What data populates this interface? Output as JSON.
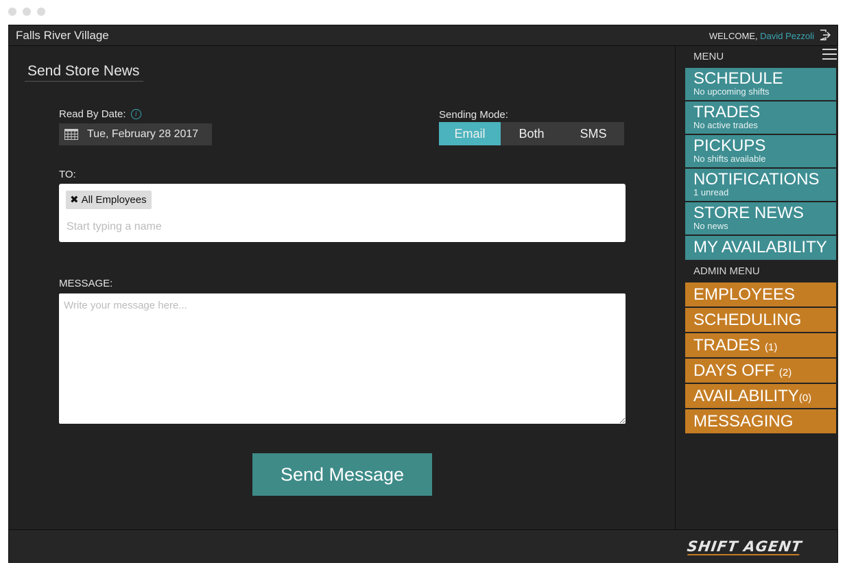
{
  "header": {
    "store_name": "Falls River Village",
    "welcome_label": "WELCOME,",
    "user_name": "David Pezzoli"
  },
  "main": {
    "page_title": "Send Store News",
    "read_by_label": "Read By Date:",
    "read_by_value": "Tue, February 28 2017",
    "sending_mode_label": "Sending Mode:",
    "modes": [
      "Email",
      "Both",
      "SMS"
    ],
    "selected_mode": "Email",
    "to_label": "TO:",
    "to_chip": "All Employees",
    "to_placeholder": "Start typing a name",
    "message_label": "MESSAGE:",
    "message_placeholder": "Write your message here...",
    "send_button": "Send Message"
  },
  "sidebar": {
    "menu_title": "MENU",
    "items": [
      {
        "label": "SCHEDULE",
        "sub": "No upcoming shifts"
      },
      {
        "label": "TRADES",
        "sub": "No active trades"
      },
      {
        "label": "PICKUPS",
        "sub": "No shifts available"
      },
      {
        "label": "NOTIFICATIONS",
        "sub": "1 unread"
      },
      {
        "label": "STORE NEWS",
        "sub": "No news"
      },
      {
        "label": "MY AVAILABILITY",
        "sub": ""
      }
    ],
    "admin_title": "ADMIN MENU",
    "admin_items": [
      {
        "label": "EMPLOYEES",
        "count": ""
      },
      {
        "label": "SCHEDULING",
        "count": ""
      },
      {
        "label": "TRADES ",
        "count": "(1)"
      },
      {
        "label": "DAYS OFF ",
        "count": "(2)"
      },
      {
        "label": "AVAILABILITY",
        "count": "(0)"
      },
      {
        "label": "MESSAGING",
        "count": ""
      }
    ],
    "colors": {
      "menu": "#3e8e92",
      "admin": "#c57d24",
      "accent": "#4bb3bd"
    }
  },
  "footer": {
    "logo_text": "SHIFT AGENT"
  }
}
